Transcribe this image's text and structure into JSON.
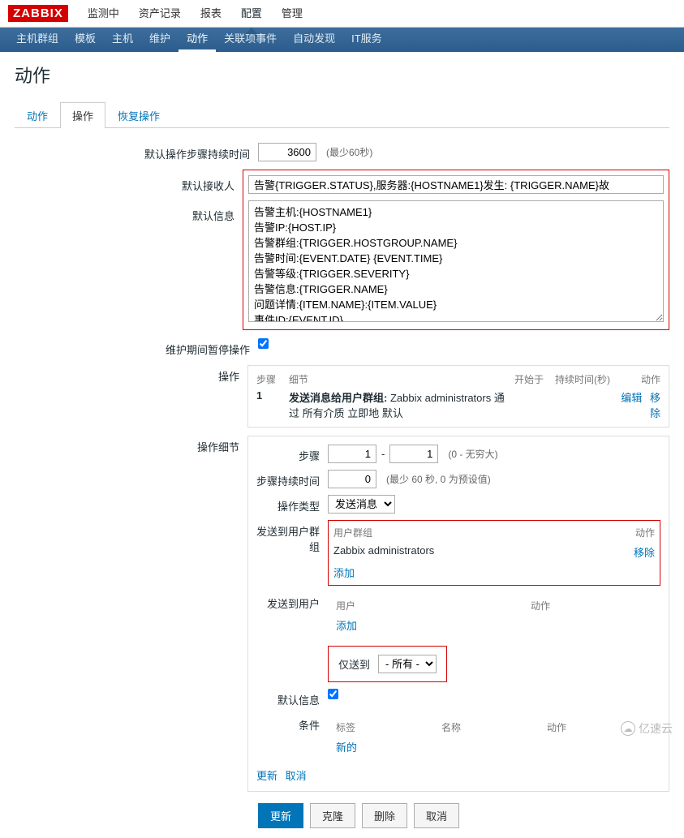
{
  "logo": "ZABBIX",
  "top_menu": {
    "items": [
      "监测中",
      "资产记录",
      "报表",
      "配置",
      "管理"
    ],
    "active_index": 3
  },
  "sub_nav": {
    "items": [
      "主机群组",
      "模板",
      "主机",
      "维护",
      "动作",
      "关联项事件",
      "自动发现",
      "IT服务"
    ],
    "active_index": 4
  },
  "page_title": "动作",
  "tabs": {
    "items": [
      "动作",
      "操作",
      "恢复操作"
    ],
    "active_index": 1
  },
  "form": {
    "step_duration_label": "默认操作步骤持续时间",
    "step_duration_value": "3600",
    "step_duration_hint": "(最少60秒)",
    "recipient_label": "默认接收人",
    "recipient_value": "告警{TRIGGER.STATUS},服务器:{HOSTNAME1}发生: {TRIGGER.NAME}故",
    "message_label": "默认信息",
    "message_value": "告警主机:{HOSTNAME1}\n告警IP:{HOST.IP}\n告警群组:{TRIGGER.HOSTGROUP.NAME}\n告警时间:{EVENT.DATE} {EVENT.TIME}\n告警等级:{TRIGGER.SEVERITY}\n告警信息:{TRIGGER.NAME}\n问题详情:{ITEM.NAME}:{ITEM.VALUE}\n事件ID:{EVENT.ID}\n---------------------------------------------------------------------",
    "pause_label": "维护期间暂停操作",
    "pause_checked": true,
    "ops_label": "操作",
    "ops": {
      "headers": {
        "step": "步骤",
        "detail": "细节",
        "start": "开始于",
        "duration": "持续时间(秒)",
        "action": "动作"
      },
      "rows": [
        {
          "step": "1",
          "detail_bold": "发送消息给用户群组:",
          "detail_rest": " Zabbix administrators 通过 所有介质 立即地 默认",
          "edit": "编辑",
          "remove": "移除"
        }
      ]
    },
    "details_label": "操作细节",
    "details": {
      "step_label": "步骤",
      "step_from": "1",
      "step_to": "1",
      "step_dash": "-",
      "step_hint": "(0 - 无穷大)",
      "dur_label": "步骤持续时间",
      "dur_value": "0",
      "dur_hint": "(最少 60 秒, 0 为预设值)",
      "type_label": "操作类型",
      "type_value": "发送消息",
      "send_group_label": "发送到用户群组",
      "group_hdr_1": "用户群组",
      "group_hdr_2": "动作",
      "group_rows": [
        {
          "name": "Zabbix administrators",
          "remove": "移除"
        }
      ],
      "add_link": "添加",
      "send_user_label": "发送到用户",
      "user_hdr_1": "用户",
      "user_hdr_2": "动作",
      "only_label": "仅送到",
      "only_value": "- 所有 -",
      "msg_label": "默认信息",
      "msg_checked": true,
      "cond_label": "条件",
      "cond_hdr_1": "标签",
      "cond_hdr_2": "名称",
      "cond_hdr_3": "动作",
      "new_link": "新的",
      "update_link": "更新",
      "cancel_link": "取消"
    }
  },
  "buttons": {
    "update": "更新",
    "clone": "克隆",
    "delete": "删除",
    "cancel": "取消"
  },
  "watermark": "亿速云"
}
